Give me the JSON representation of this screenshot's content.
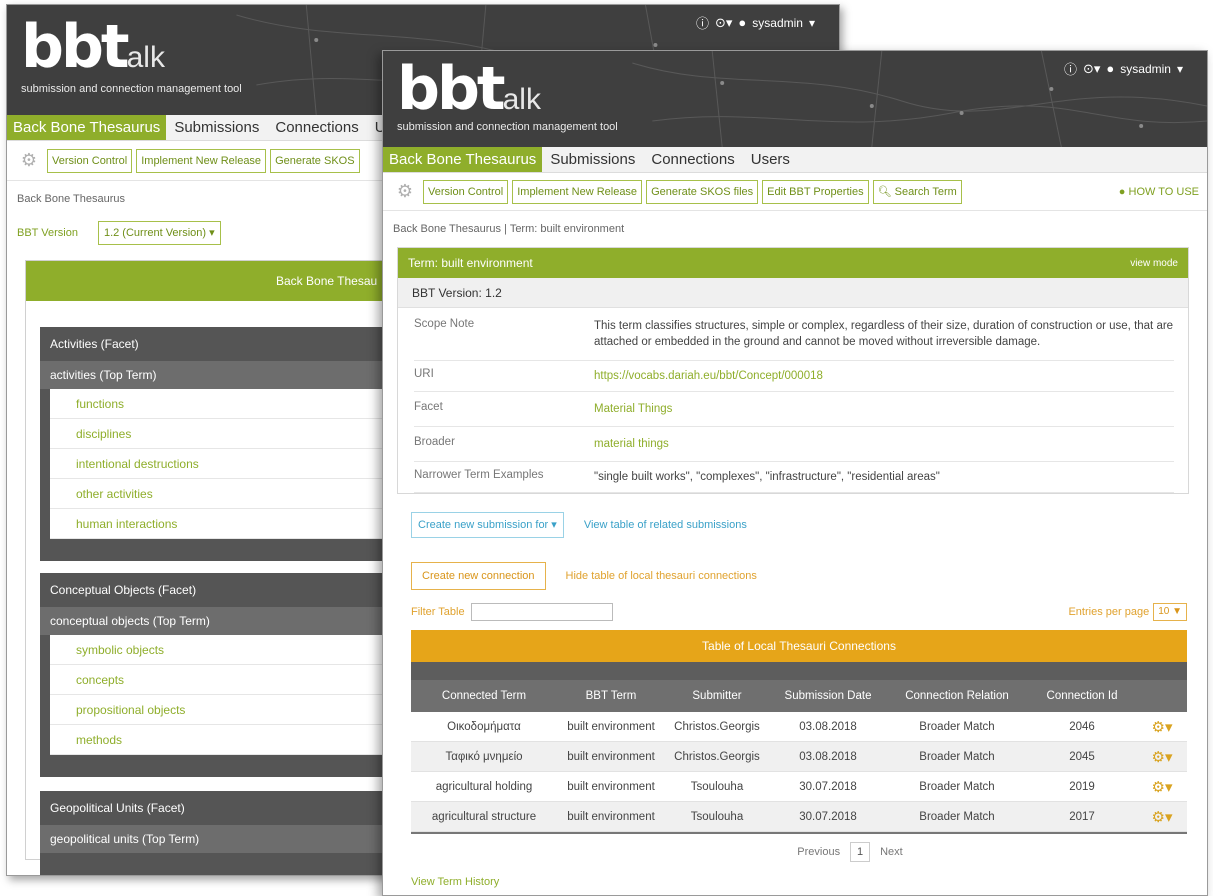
{
  "app": {
    "logo_main": "bbt",
    "logo_suffix": "alk",
    "tagline": "submission and connection management tool",
    "user": "sysadmin",
    "info_icon": "info-icon",
    "help_icon": "help-icon",
    "user_icon": "user-icon"
  },
  "nav": {
    "bbt": "Back Bone Thesaurus",
    "submissions": "Submissions",
    "connections": "Connections",
    "users": "Users",
    "users_cut": "U"
  },
  "toolbar": {
    "version_control": "Version Control",
    "implement_release": "Implement New Release",
    "generate_skos": "Generate SKOS files",
    "generate_skos_cut": "Generate SKOS",
    "edit_props": "Edit BBT Properties",
    "search_term": "Search Term",
    "how_to_use": "HOW TO USE"
  },
  "back": {
    "crumb": "Back Bone Thesaurus",
    "version_label": "BBT Version",
    "version_value": "1.2 (Current Version) ▾",
    "panel_title": "Back Bone Thesau",
    "facets": [
      {
        "name": "Activities (Facet)",
        "top": "activities (Top Term)",
        "items": [
          "functions",
          "disciplines",
          "intentional destructions",
          "other activities",
          "human interactions"
        ]
      },
      {
        "name": "Conceptual Objects (Facet)",
        "top": "conceptual objects (Top Term)",
        "items": [
          "symbolic objects",
          "concepts",
          "propositional objects",
          "methods"
        ]
      },
      {
        "name": "Geopolitical Units (Facet)",
        "top": "geopolitical units (Top Term)",
        "items": []
      }
    ]
  },
  "front": {
    "crumb_root": "Back Bone Thesaurus",
    "crumb_sep": " | ",
    "crumb_term": "Term: built environment",
    "term_header": "Term: built environment",
    "view_mode": "view mode",
    "bbt_version": "BBT Version: 1.2",
    "props": [
      {
        "k": "Scope Note",
        "v": "This term classifies structures, simple or complex, regardless of their size, duration of construction or use, that are attached or embedded in the ground and cannot be moved without irreversible damage.",
        "link": false
      },
      {
        "k": "URI",
        "v": "https://vocabs.dariah.eu/bbt/Concept/000018",
        "link": true
      },
      {
        "k": "Facet",
        "v": "Material Things",
        "link": true
      },
      {
        "k": "Broader",
        "v": "material things",
        "link": true
      },
      {
        "k": "Narrower Term Examples",
        "v": "\"single built works\", \"complexes\", \"infrastructure\", \"residential areas\"",
        "link": false
      }
    ],
    "create_submission": "Create new submission for ▾",
    "view_submissions": "View table of related submissions",
    "create_connection": "Create new connection",
    "hide_connections": "Hide table of local thesauri connections",
    "filter_label": "Filter Table",
    "entries_label": "Entries per page",
    "entries_value": "10 ▼",
    "table_title": "Table of Local Thesauri Connections",
    "columns": [
      "Connected Term",
      "BBT Term",
      "Submitter",
      "Submission Date",
      "Connection Relation",
      "Connection Id"
    ],
    "rows": [
      [
        "Οικοδομήματα",
        "built environment",
        "Christos.Georgis",
        "03.08.2018",
        "Broader Match",
        "2046"
      ],
      [
        "Ταφικό μνημείο",
        "built environment",
        "Christos.Georgis",
        "03.08.2018",
        "Broader Match",
        "2045"
      ],
      [
        "agricultural holding",
        "built environment",
        "Tsoulouha",
        "30.07.2018",
        "Broader Match",
        "2019"
      ],
      [
        "agricultural structure",
        "built environment",
        "Tsoulouha",
        "30.07.2018",
        "Broader Match",
        "2017"
      ]
    ],
    "row_action": "⚙▾",
    "pager_prev": "Previous",
    "pager_page": "1",
    "pager_next": "Next",
    "view_history": "View Term History"
  }
}
